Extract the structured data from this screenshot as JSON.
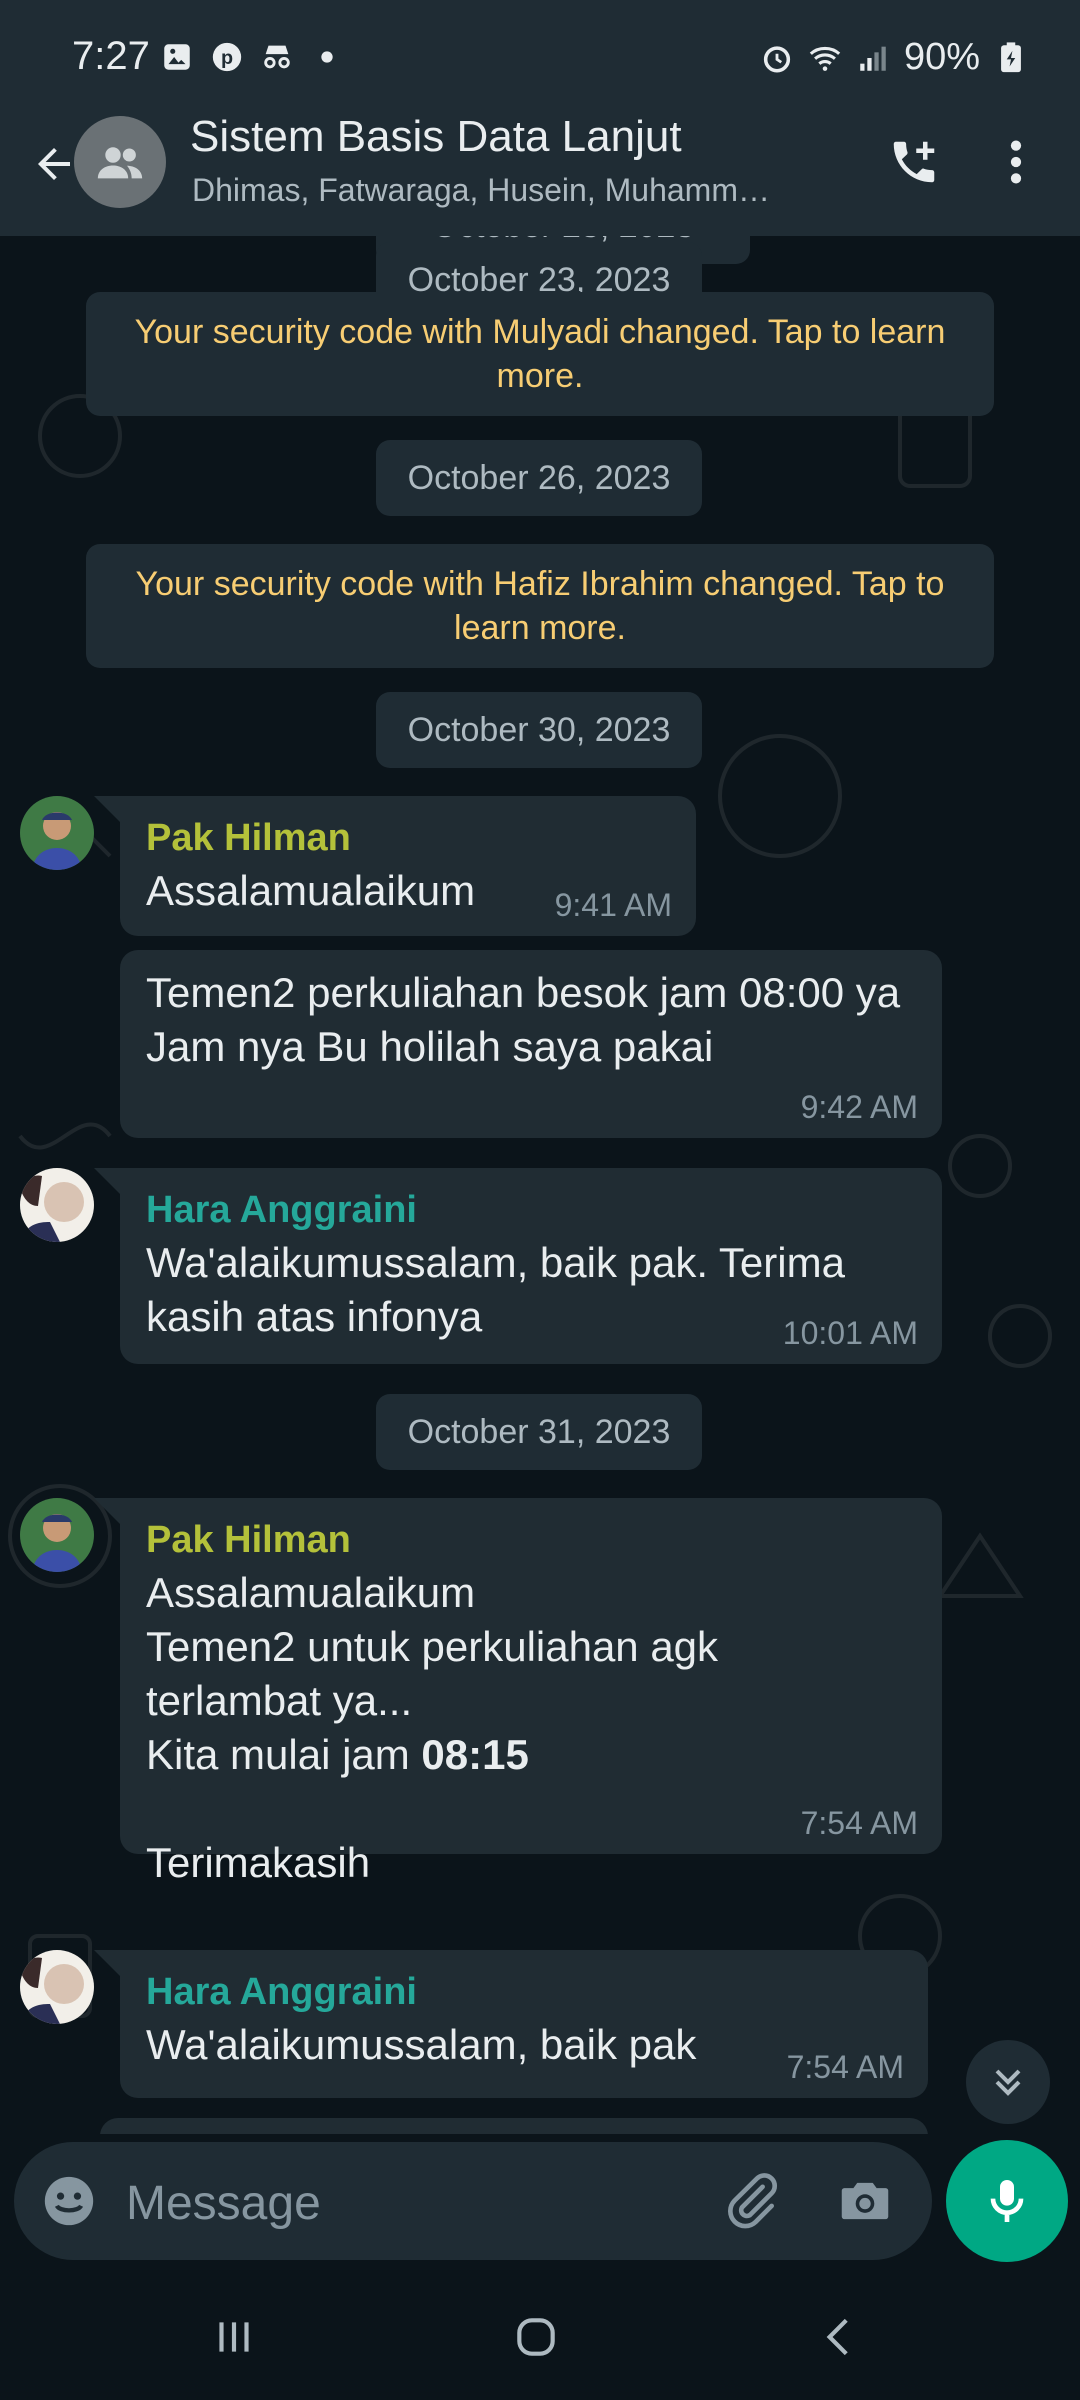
{
  "status_bar": {
    "time": "7:27",
    "battery": "90%"
  },
  "header": {
    "title": "Sistem Basis Data Lanjut",
    "participants": "Dhimas, Fatwaraga, Husein, Muhamm…"
  },
  "chat": {
    "clipped_date": "October 23, 2023",
    "dates": [
      "October 23, 2023",
      "October 26, 2023",
      "October 30, 2023",
      "October 31, 2023"
    ],
    "system_messages": [
      "Your security code with Mulyadi changed. Tap to learn more.",
      "Your security code with Hafiz Ibrahim changed. Tap to learn more."
    ],
    "messages": [
      {
        "sender": "Pak Hilman",
        "sender_color": "#b4c13a",
        "text": "Assalamualaikum",
        "time": "9:41 AM"
      },
      {
        "sender": "",
        "text": "Temen2 perkuliahan besok jam 08:00 ya\nJam nya Bu holilah saya pakai",
        "time": "9:42 AM"
      },
      {
        "sender": "Hara Anggraini",
        "sender_color": "#25a89a",
        "text": "Wa'alaikumussalam, baik pak. Terima kasih atas infonya",
        "time": "10:01 AM"
      },
      {
        "sender": "Pak Hilman",
        "sender_color": "#b4c13a",
        "text_lines": [
          "Assalamualaikum",
          "Temen2 untuk perkuliahan agk terlambat ya...",
          "Kita mulai jam "
        ],
        "bold_part": "08:15",
        "closing": "Terimakasih",
        "time": "7:54 AM"
      },
      {
        "sender": "Hara Anggraini",
        "sender_color": "#25a89a",
        "text": "Wa'alaikumussalam, baik pak",
        "time": "7:54 AM"
      }
    ]
  },
  "input": {
    "placeholder": "Message"
  },
  "colors": {
    "accent": "#00a884",
    "system_text": "#f7cd73",
    "bubble": "#202c33",
    "header": "#1f2c34"
  },
  "icons": [
    "back-arrow-icon",
    "group-icon",
    "call-add-icon",
    "more-vert-icon",
    "emoji-icon",
    "attach-icon",
    "camera-icon",
    "mic-icon",
    "chevron-double-down-icon",
    "nav-recents-icon",
    "nav-home-icon",
    "nav-back-icon"
  ]
}
